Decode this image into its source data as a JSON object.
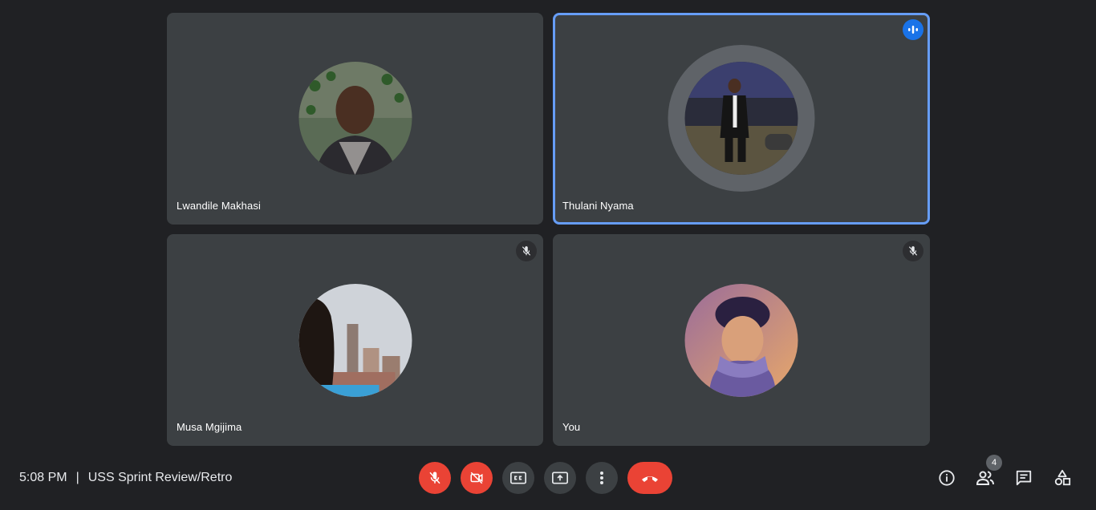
{
  "participants": [
    {
      "name": "Lwandile Makhasi",
      "avatar": "photo-man-portrait-plants",
      "muted": false,
      "speaking": false
    },
    {
      "name": "Thulani Nyama",
      "avatar": "photo-man-suit-night",
      "muted": false,
      "speaking": true
    },
    {
      "name": "Musa Mgijima",
      "avatar": "photo-city-skyline",
      "muted": true,
      "speaking": false
    },
    {
      "name": "You",
      "avatar": "illustration-anime-scarf",
      "muted": true,
      "speaking": false
    }
  ],
  "footer": {
    "time": "5:08 PM",
    "separator": "|",
    "meeting_title": "USS Sprint Review/Retro"
  },
  "controls": {
    "mic": {
      "icon": "mic-off-icon",
      "state": "off"
    },
    "camera": {
      "icon": "videocam-off-icon",
      "state": "off"
    },
    "captions": {
      "icon": "closed-captions-icon"
    },
    "present": {
      "icon": "present-screen-icon"
    },
    "more": {
      "icon": "more-vert-icon"
    },
    "leave": {
      "icon": "call-end-icon"
    }
  },
  "side_panel": {
    "info_icon": "info-icon",
    "people_icon": "people-icon",
    "people_count": "4",
    "chat_icon": "chat-icon",
    "activities_icon": "activities-icon"
  },
  "colors": {
    "background": "#202124",
    "tile": "#3c4043",
    "speaking_border": "#669df6",
    "danger": "#ea4335",
    "accent": "#1a73e8"
  }
}
